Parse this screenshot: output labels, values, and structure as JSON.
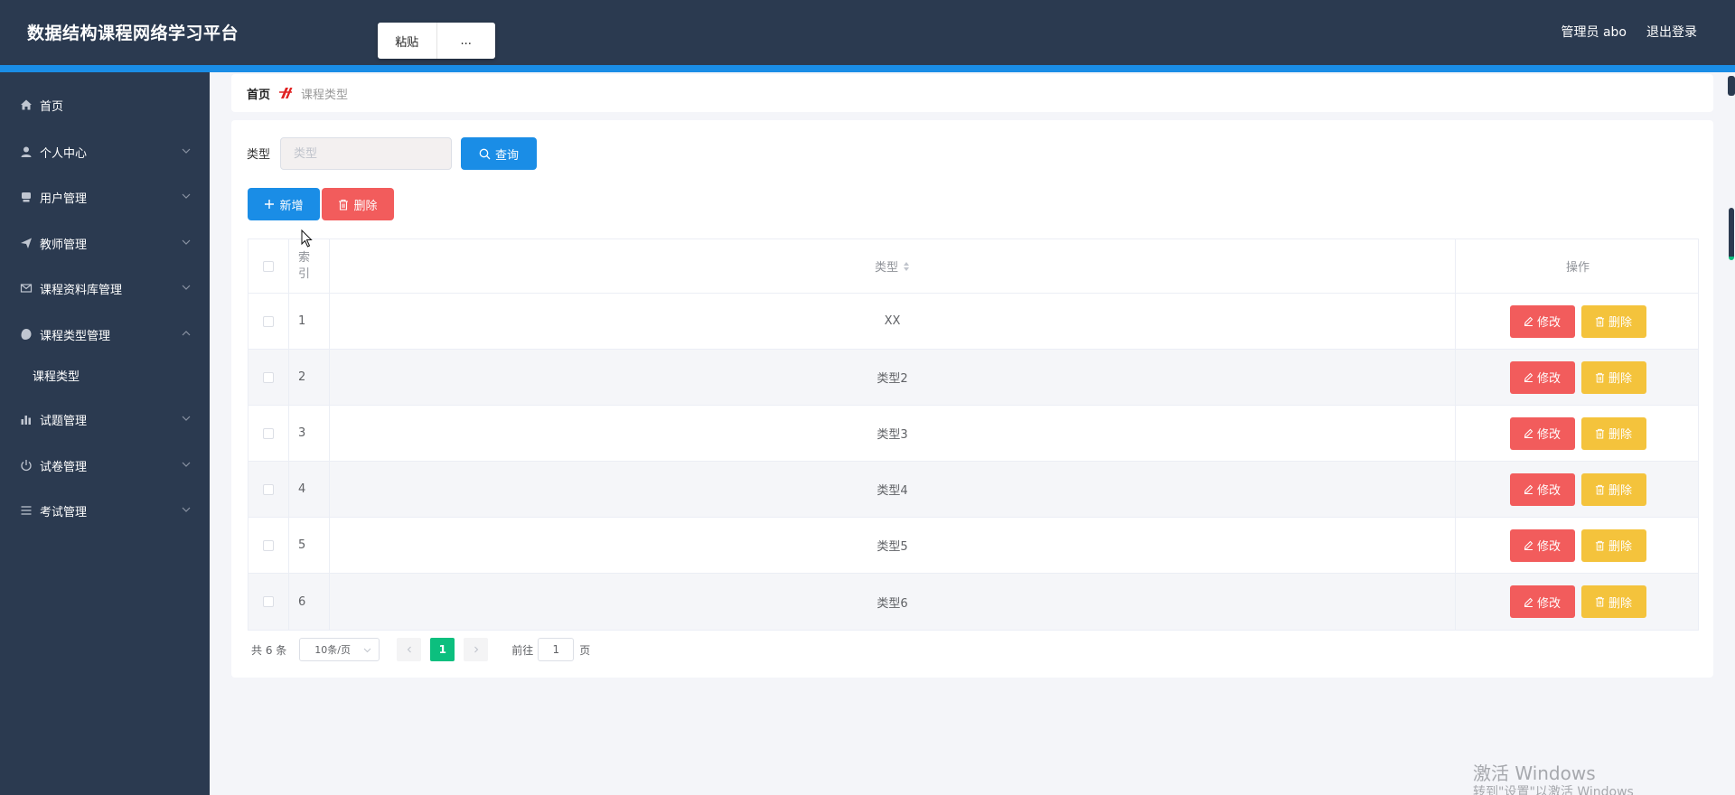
{
  "header": {
    "app_title": "数据结构课程网络学习平台",
    "context_menu": [
      "粘贴",
      "..."
    ],
    "user": "管理员 abo",
    "logout": "退出登录"
  },
  "sidebar": {
    "items": [
      {
        "label": "首页",
        "icon": "home-icon"
      },
      {
        "label": "个人中心",
        "icon": "user-icon"
      },
      {
        "label": "用户管理",
        "icon": "users-icon"
      },
      {
        "label": "教师管理",
        "icon": "send-icon"
      },
      {
        "label": "课程资料库管理",
        "icon": "mail-icon"
      },
      {
        "label": "课程类型管理",
        "icon": "tag-icon"
      },
      {
        "label": "试题管理",
        "icon": "chart-icon"
      },
      {
        "label": "试卷管理",
        "icon": "power-icon"
      },
      {
        "label": "考试管理",
        "icon": "list-icon"
      }
    ],
    "sub_item": "课程类型"
  },
  "breadcrumb": {
    "home": "首页",
    "current": "课程类型"
  },
  "filter": {
    "label": "类型",
    "placeholder": "类型",
    "query_button": "查询"
  },
  "toolbar": {
    "add_button": "新增",
    "delete_button": "删除"
  },
  "table": {
    "headers": {
      "index": "索引",
      "type": "类型",
      "actions": "操作"
    },
    "rows": [
      {
        "index": "1",
        "type": "XX"
      },
      {
        "index": "2",
        "type": "类型2"
      },
      {
        "index": "3",
        "type": "类型3"
      },
      {
        "index": "4",
        "type": "类型4"
      },
      {
        "index": "5",
        "type": "类型5"
      },
      {
        "index": "6",
        "type": "类型6"
      }
    ],
    "edit_label": "修改",
    "delete_label": "删除"
  },
  "pagination": {
    "total": "共 6 条",
    "page_size": "10条/页",
    "current_page": "1",
    "goto_prefix": "前往",
    "goto_value": "1",
    "goto_suffix": "页"
  },
  "watermark": {
    "line1": "激活 Windows",
    "line2": "转到\"设置\"以激活 Windows"
  },
  "colors": {
    "header_bg": "#2b3a50",
    "primary": "#1a8de6",
    "danger": "#f25c5c",
    "warning": "#f4c33c",
    "success": "#0cbf7e"
  }
}
